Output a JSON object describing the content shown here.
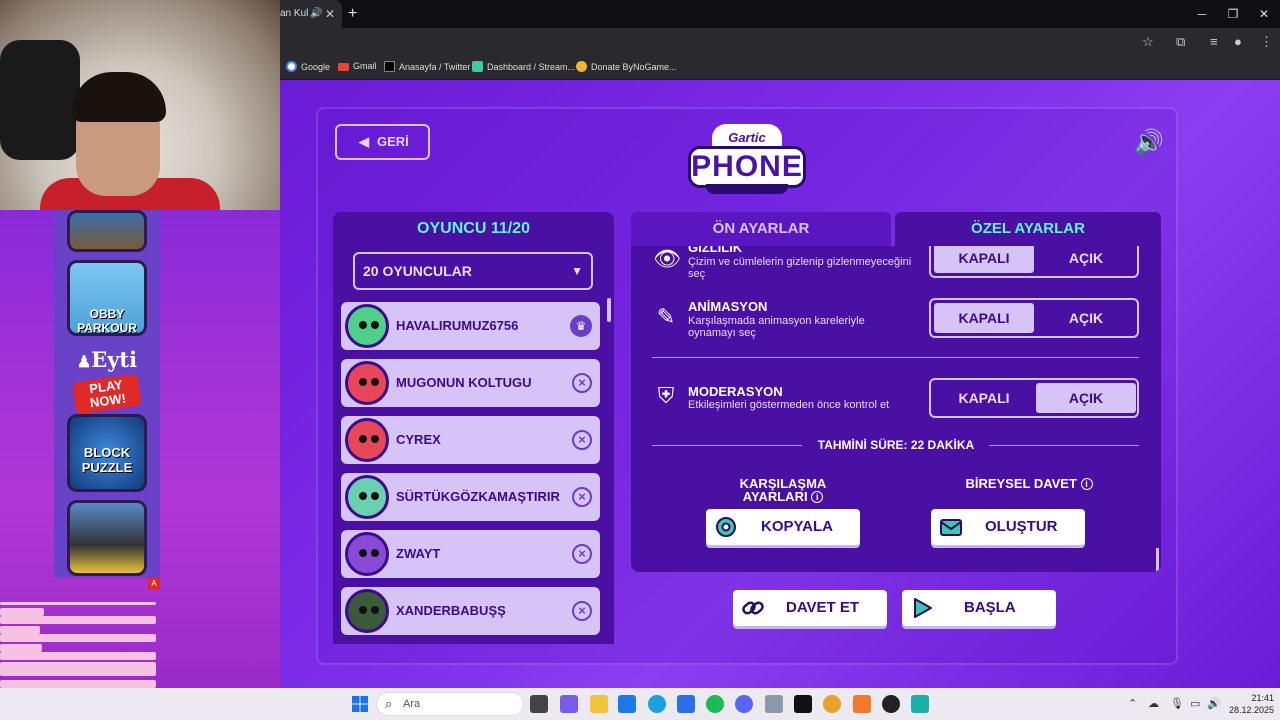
{
  "browser": {
    "tab_title": "an Kul",
    "bookmarks": [
      "Google",
      "Gmail",
      "Anasayfa / Twitter",
      "Dashboard / Stream...",
      "Donate ByNoGame..."
    ]
  },
  "ads": {
    "ad1_text": "",
    "ad2_text": "OBBY PARKOUR",
    "brand": "Eyti",
    "play_now": "PLAY NOW!",
    "ad3_text": "BLOCK PUZZLE",
    "badge": "A"
  },
  "game": {
    "back_label": "GERİ",
    "logo_top": "Gartic",
    "logo_main": "PHONE",
    "players_title": "OYUNCU 11/20",
    "players_select": "20 OYUNCULAR",
    "players": [
      {
        "name": "HAVALIRUMUZ6756",
        "host": true,
        "color": "#4fd08a"
      },
      {
        "name": "MUGONUN KOLTUGU",
        "host": false,
        "color": "#e8475a"
      },
      {
        "name": "CYREX",
        "host": false,
        "color": "#e8475a"
      },
      {
        "name": "SÜRTÜKGÖZKAMAŞTIRIR",
        "host": false,
        "color": "#6ad0b0"
      },
      {
        "name": "ZWAYT",
        "host": false,
        "color": "#8a4ad8"
      },
      {
        "name": "XANDERBABUŞŞ",
        "host": false,
        "color": "#3a5a3a"
      }
    ],
    "tabs": {
      "presets": "ÖN AYARLAR",
      "custom": "ÖZEL AYARLAR"
    },
    "settings": {
      "hidden": {
        "title": "GİZLİLİK",
        "desc": "Çizim ve cümlelerin gizlenip gizlenmeyeceğini seç",
        "value": "KAPALI"
      },
      "animation": {
        "title": "ANİMASYON",
        "desc": "Karşılaşmada animasyon kareleriyle oynamayı seç",
        "value": "KAPALI"
      },
      "moderation": {
        "title": "MODERASYON",
        "desc": "Etkileşimleri göstermeden önce kontrol et",
        "value": "AÇIK"
      },
      "off_label": "KAPALI",
      "on_label": "AÇIK"
    },
    "estimate": "TAHMİNİ SÜRE: 22 DAKİKA",
    "match_settings_label": "KARŞILAŞMA AYARLARI",
    "copy_label": "KOPYALA",
    "individual_invite_label": "BİREYSEL DAVET",
    "create_label": "OLUŞTUR",
    "invite_label": "DAVET ET",
    "start_label": "BAŞLA",
    "accent": "#5ef6d4"
  },
  "taskbar": {
    "search_placeholder": "Ara",
    "time": "21:41",
    "date": "28.12.2025"
  }
}
